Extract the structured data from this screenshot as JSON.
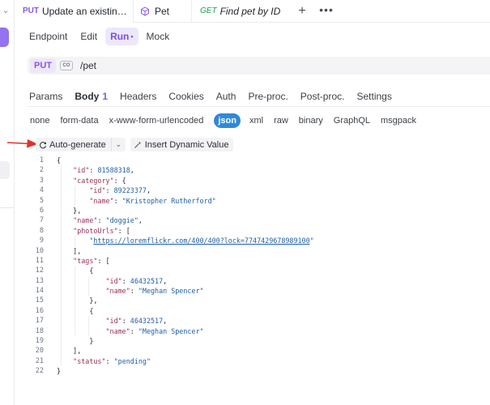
{
  "tabs": [
    {
      "method": "PUT",
      "label": "Update an existin…",
      "active": true,
      "unsaved": true
    },
    {
      "icon": "cube-icon",
      "label": "Pet"
    },
    {
      "method": "GET",
      "label": "Find pet by ID"
    }
  ],
  "tab_actions": {
    "add": "+",
    "more": "•••"
  },
  "modes": [
    {
      "label": "Endpoint"
    },
    {
      "label": "Edit"
    },
    {
      "label": "Run",
      "active": true,
      "marker": "•"
    },
    {
      "label": "Mock"
    }
  ],
  "request": {
    "method": "PUT",
    "badge": "CO",
    "path": "/pet"
  },
  "request_tabs": [
    {
      "label": "Params"
    },
    {
      "label": "Body",
      "count": "1",
      "active": true
    },
    {
      "label": "Headers"
    },
    {
      "label": "Cookies"
    },
    {
      "label": "Auth"
    },
    {
      "label": "Pre-proc."
    },
    {
      "label": "Post-proc."
    },
    {
      "label": "Settings"
    }
  ],
  "body_types": [
    "none",
    "form-data",
    "x-www-form-urlencoded",
    "json",
    "xml",
    "raw",
    "binary",
    "GraphQL",
    "msgpack"
  ],
  "body_type_selected": "json",
  "actions": {
    "auto_generate": "Auto-generate",
    "insert_dynamic": "Insert Dynamic Value"
  },
  "colors": {
    "accent": "#8a56e8",
    "json_chip": "#2f89d8",
    "arrow": "#e0322b"
  },
  "code_lines": [
    [
      {
        "t": "p",
        "v": "{"
      }
    ],
    [
      {
        "t": "p",
        "v": "    "
      },
      {
        "t": "k",
        "v": "\"id\""
      },
      {
        "t": "p",
        "v": ": "
      },
      {
        "t": "n",
        "v": "81588318"
      },
      {
        "t": "p",
        "v": ","
      }
    ],
    [
      {
        "t": "p",
        "v": "    "
      },
      {
        "t": "k",
        "v": "\"category\""
      },
      {
        "t": "p",
        "v": ": {"
      }
    ],
    [
      {
        "t": "p",
        "v": "        "
      },
      {
        "t": "k",
        "v": "\"id\""
      },
      {
        "t": "p",
        "v": ": "
      },
      {
        "t": "n",
        "v": "89223377"
      },
      {
        "t": "p",
        "v": ","
      }
    ],
    [
      {
        "t": "p",
        "v": "        "
      },
      {
        "t": "k",
        "v": "\"name\""
      },
      {
        "t": "p",
        "v": ": "
      },
      {
        "t": "s",
        "v": "\"Kristopher Rutherford\""
      }
    ],
    [
      {
        "t": "p",
        "v": "    },"
      }
    ],
    [
      {
        "t": "p",
        "v": "    "
      },
      {
        "t": "k",
        "v": "\"name\""
      },
      {
        "t": "p",
        "v": ": "
      },
      {
        "t": "s",
        "v": "\"doggie\""
      },
      {
        "t": "p",
        "v": ","
      }
    ],
    [
      {
        "t": "p",
        "v": "    "
      },
      {
        "t": "k",
        "v": "\"photoUrls\""
      },
      {
        "t": "p",
        "v": ": ["
      }
    ],
    [
      {
        "t": "p",
        "v": "        "
      },
      {
        "t": "s",
        "v": "\""
      },
      {
        "t": "url",
        "v": "https://loremflickr.com/400/400?lock=7747429678989100"
      },
      {
        "t": "s",
        "v": "\""
      }
    ],
    [
      {
        "t": "p",
        "v": "    ],"
      }
    ],
    [
      {
        "t": "p",
        "v": "    "
      },
      {
        "t": "k",
        "v": "\"tags\""
      },
      {
        "t": "p",
        "v": ": ["
      }
    ],
    [
      {
        "t": "p",
        "v": "        {"
      }
    ],
    [
      {
        "t": "p",
        "v": "            "
      },
      {
        "t": "k",
        "v": "\"id\""
      },
      {
        "t": "p",
        "v": ": "
      },
      {
        "t": "n",
        "v": "46432517"
      },
      {
        "t": "p",
        "v": ","
      }
    ],
    [
      {
        "t": "p",
        "v": "            "
      },
      {
        "t": "k",
        "v": "\"name\""
      },
      {
        "t": "p",
        "v": ": "
      },
      {
        "t": "s",
        "v": "\"Meghan Spencer\""
      }
    ],
    [
      {
        "t": "p",
        "v": "        },"
      }
    ],
    [
      {
        "t": "p",
        "v": "        {"
      }
    ],
    [
      {
        "t": "p",
        "v": "            "
      },
      {
        "t": "k",
        "v": "\"id\""
      },
      {
        "t": "p",
        "v": ": "
      },
      {
        "t": "n",
        "v": "46432517"
      },
      {
        "t": "p",
        "v": ","
      }
    ],
    [
      {
        "t": "p",
        "v": "            "
      },
      {
        "t": "k",
        "v": "\"name\""
      },
      {
        "t": "p",
        "v": ": "
      },
      {
        "t": "s",
        "v": "\"Meghan Spencer\""
      }
    ],
    [
      {
        "t": "p",
        "v": "        }"
      }
    ],
    [
      {
        "t": "p",
        "v": "    ],"
      }
    ],
    [
      {
        "t": "p",
        "v": "    "
      },
      {
        "t": "k",
        "v": "\"status\""
      },
      {
        "t": "p",
        "v": ": "
      },
      {
        "t": "s",
        "v": "\"pending\""
      }
    ],
    [
      {
        "t": "p",
        "v": "}"
      }
    ]
  ]
}
